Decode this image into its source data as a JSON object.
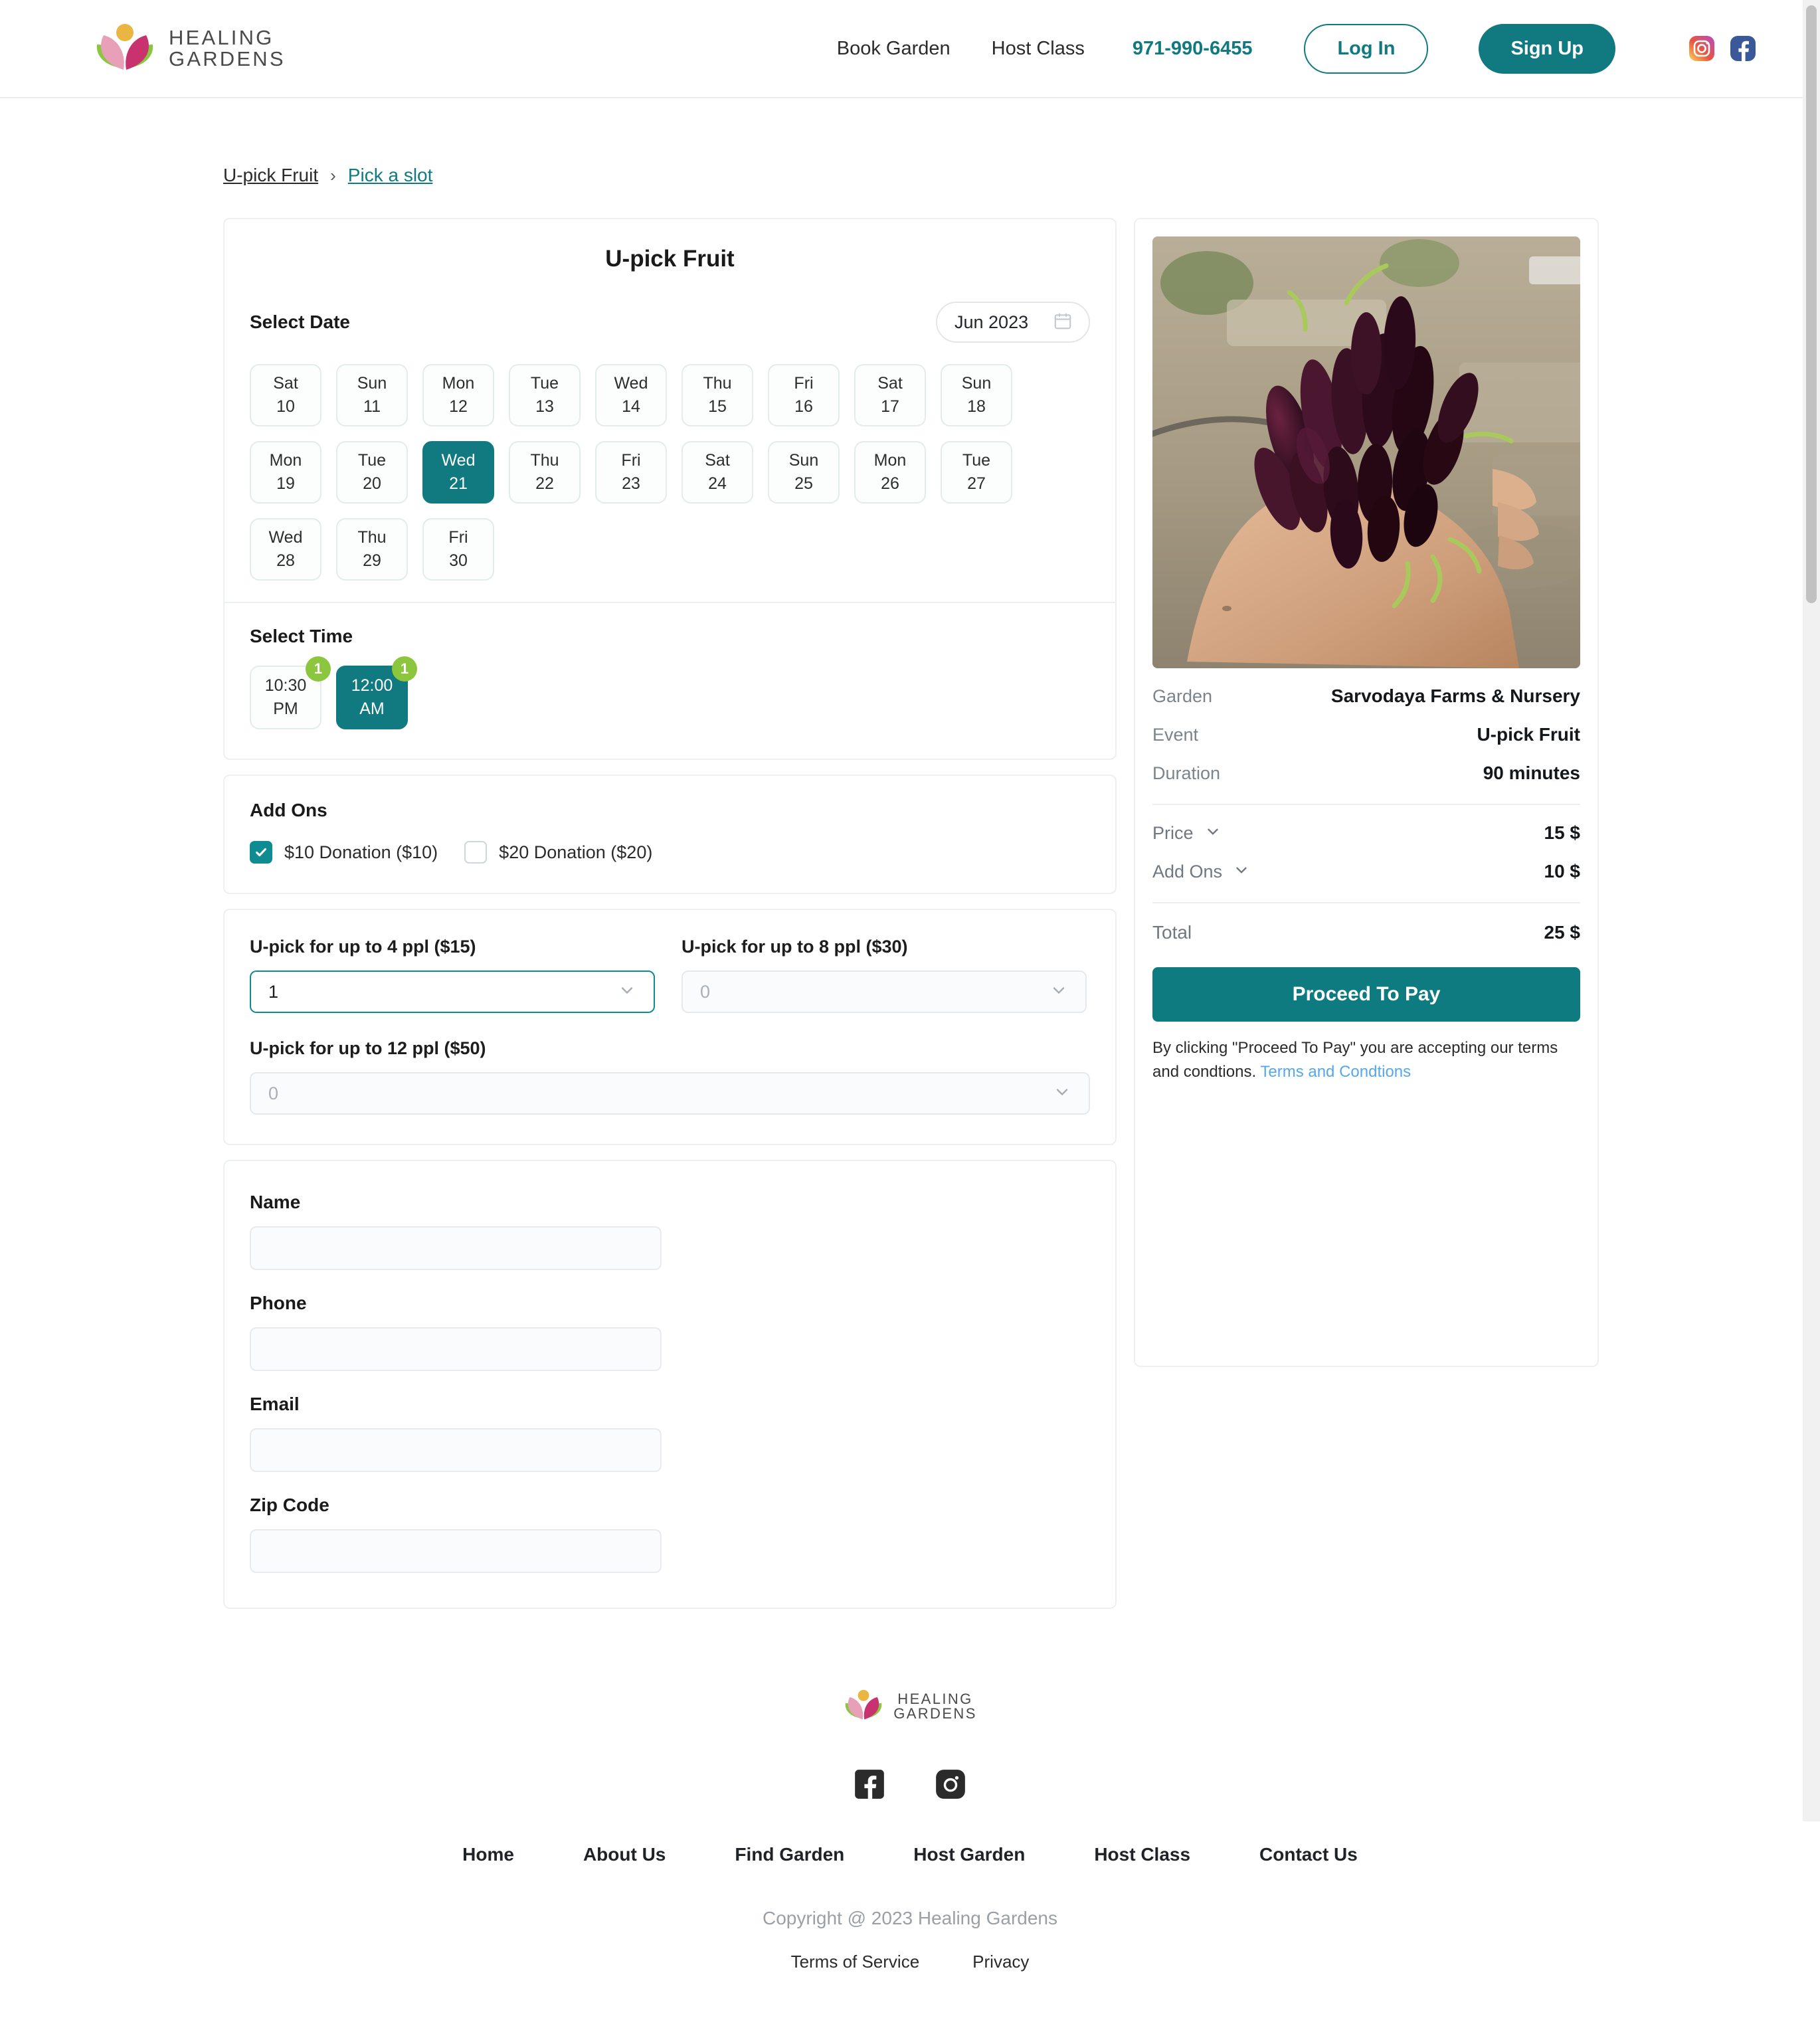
{
  "header": {
    "logo_line1": "HEALING",
    "logo_line2": "GARDENS",
    "nav": [
      {
        "label": "Book Garden"
      },
      {
        "label": "Host Class"
      }
    ],
    "phone": "971-990-6455",
    "login_label": "Log In",
    "signup_label": "Sign Up",
    "social": [
      "instagram-icon",
      "facebook-icon"
    ]
  },
  "breadcrumb": {
    "parent": "U-pick Fruit",
    "separator": "›",
    "current": "Pick a slot"
  },
  "booking": {
    "title": "U-pick Fruit",
    "select_date_label": "Select Date",
    "month_value": "Jun 2023",
    "calendar_icon": "calendar-icon",
    "dates": [
      {
        "dow": "Sat",
        "day": "10",
        "selected": false
      },
      {
        "dow": "Sun",
        "day": "11",
        "selected": false
      },
      {
        "dow": "Mon",
        "day": "12",
        "selected": false
      },
      {
        "dow": "Tue",
        "day": "13",
        "selected": false
      },
      {
        "dow": "Wed",
        "day": "14",
        "selected": false
      },
      {
        "dow": "Thu",
        "day": "15",
        "selected": false
      },
      {
        "dow": "Fri",
        "day": "16",
        "selected": false
      },
      {
        "dow": "Sat",
        "day": "17",
        "selected": false
      },
      {
        "dow": "Sun",
        "day": "18",
        "selected": false
      },
      {
        "dow": "Mon",
        "day": "19",
        "selected": false
      },
      {
        "dow": "Tue",
        "day": "20",
        "selected": false
      },
      {
        "dow": "Wed",
        "day": "21",
        "selected": true
      },
      {
        "dow": "Thu",
        "day": "22",
        "selected": false
      },
      {
        "dow": "Fri",
        "day": "23",
        "selected": false
      },
      {
        "dow": "Sat",
        "day": "24",
        "selected": false
      },
      {
        "dow": "Sun",
        "day": "25",
        "selected": false
      },
      {
        "dow": "Mon",
        "day": "26",
        "selected": false
      },
      {
        "dow": "Tue",
        "day": "27",
        "selected": false
      },
      {
        "dow": "Wed",
        "day": "28",
        "selected": false
      },
      {
        "dow": "Thu",
        "day": "29",
        "selected": false
      },
      {
        "dow": "Fri",
        "day": "30",
        "selected": false
      }
    ],
    "select_time_label": "Select Time",
    "times": [
      {
        "time": "10:30",
        "meridiem": "PM",
        "badge": "1",
        "selected": false
      },
      {
        "time": "12:00",
        "meridiem": "AM",
        "badge": "1",
        "selected": true
      }
    ],
    "addons_label": "Add Ons",
    "addons": [
      {
        "label": "$10 Donation ($10)",
        "checked": true
      },
      {
        "label": "$20 Donation ($20)",
        "checked": false
      }
    ],
    "tickets": [
      {
        "label": "U-pick for up to 4 ppl ($15)",
        "value": "1",
        "placeholder": "0",
        "active": true
      },
      {
        "label": "U-pick for up to 8 ppl ($30)",
        "value": "",
        "placeholder": "0",
        "active": false
      },
      {
        "label": "U-pick for up to 12 ppl ($50)",
        "value": "",
        "placeholder": "0",
        "active": false
      }
    ],
    "contact": [
      {
        "label": "Name",
        "value": "",
        "placeholder": ""
      },
      {
        "label": "Phone",
        "value": "",
        "placeholder": ""
      },
      {
        "label": "Email",
        "value": "",
        "placeholder": ""
      },
      {
        "label": "Zip Code",
        "value": "",
        "placeholder": ""
      }
    ]
  },
  "summary": {
    "image_alt": "hand-holding-mulberries-photo",
    "garden_key": "Garden",
    "garden_value": "Sarvodaya Farms & Nursery",
    "event_key": "Event",
    "event_value": "U-pick Fruit",
    "duration_key": "Duration",
    "duration_value": "90 minutes",
    "price_key": "Price",
    "price_value": "15 $",
    "addons_key": "Add Ons",
    "addons_value": "10 $",
    "total_key": "Total",
    "total_value": "25 $",
    "pay_button": "Proceed To Pay",
    "terms_text": "By clicking \"Proceed To Pay\" you are accepting our terms and condtions. ",
    "terms_link": "Terms and Condtions"
  },
  "footer": {
    "logo_line1": "HEALING",
    "logo_line2": "GARDENS",
    "social": [
      "facebook-icon",
      "instagram-icon"
    ],
    "nav": [
      {
        "label": "Home"
      },
      {
        "label": "About Us"
      },
      {
        "label": "Find Garden"
      },
      {
        "label": "Host Garden"
      },
      {
        "label": "Host Class"
      },
      {
        "label": "Contact Us"
      }
    ],
    "copyright": "Copyright @ 2023 Healing Gardens",
    "legal": [
      {
        "label": "Terms of Service"
      },
      {
        "label": "Privacy"
      }
    ]
  },
  "colors": {
    "teal": "#107A80",
    "badge_green": "#8CC63E",
    "link_blue": "#56A8E8"
  }
}
